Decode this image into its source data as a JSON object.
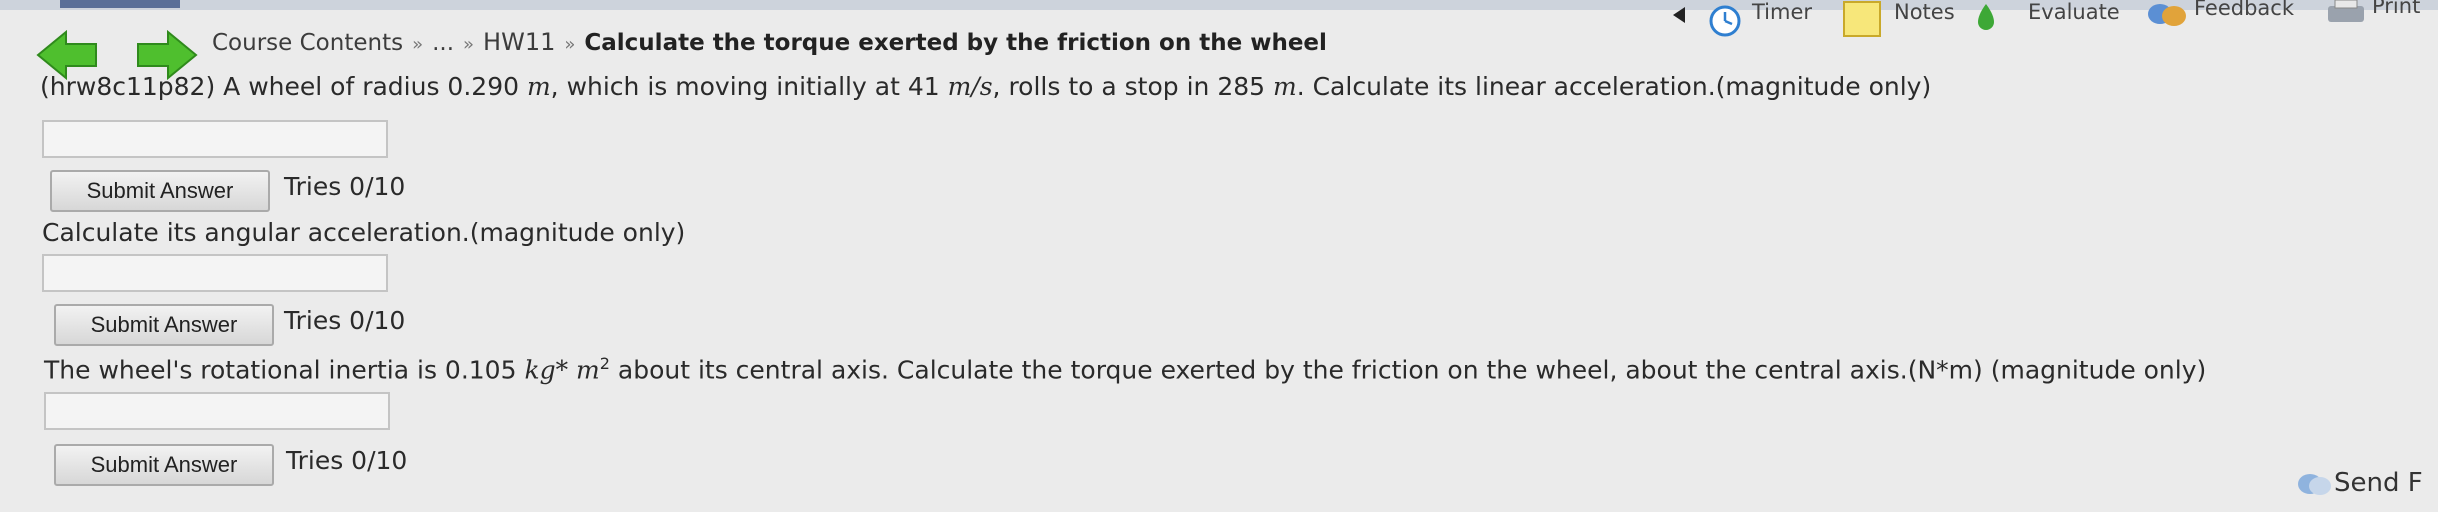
{
  "nav": {
    "back_icon": "back-arrow-icon",
    "forward_icon": "forward-arrow-icon",
    "arrow_color": "#4fbf2e"
  },
  "breadcrumb": {
    "course_contents": "Course Contents",
    "ellipsis": "...",
    "separator": "»",
    "hw": "HW11",
    "current": "Calculate the torque exerted by the friction on the wheel"
  },
  "toolbar": {
    "timer_label": "Timer",
    "notes_label": "Notes",
    "evaluate_label": "Evaluate",
    "feedback_label": "Feedback",
    "print_label": "Print"
  },
  "questions": [
    {
      "text_prefix": "(hrw8c11p82) A wheel of radius 0.290 ",
      "text_unit1": "m",
      "text_mid1": ", which is moving initially at 41 ",
      "text_unit2": "m/s",
      "text_mid2": ", rolls to a stop in 285 ",
      "text_unit3": "m",
      "text_suffix": ". Calculate its linear acceleration.(magnitude only)",
      "answer_value": "",
      "submit_label": "Submit Answer",
      "tries": "Tries 0/10"
    },
    {
      "text": "Calculate its angular acceleration.(magnitude only)",
      "answer_value": "",
      "submit_label": "Submit Answer",
      "tries": "Tries 0/10"
    },
    {
      "text_prefix": "The wheel's rotational inertia is 0.105 ",
      "text_unit1": "kg* m",
      "text_sup": "2",
      "text_suffix": " about its central axis. Calculate the torque exerted by the friction on the wheel, about the central axis.(N*m) (magnitude only)",
      "answer_value": "",
      "submit_label": "Submit Answer",
      "tries": "Tries 0/10"
    }
  ],
  "footer": {
    "send_label": "Send F",
    "send_icon": "send-feedback-icon"
  }
}
